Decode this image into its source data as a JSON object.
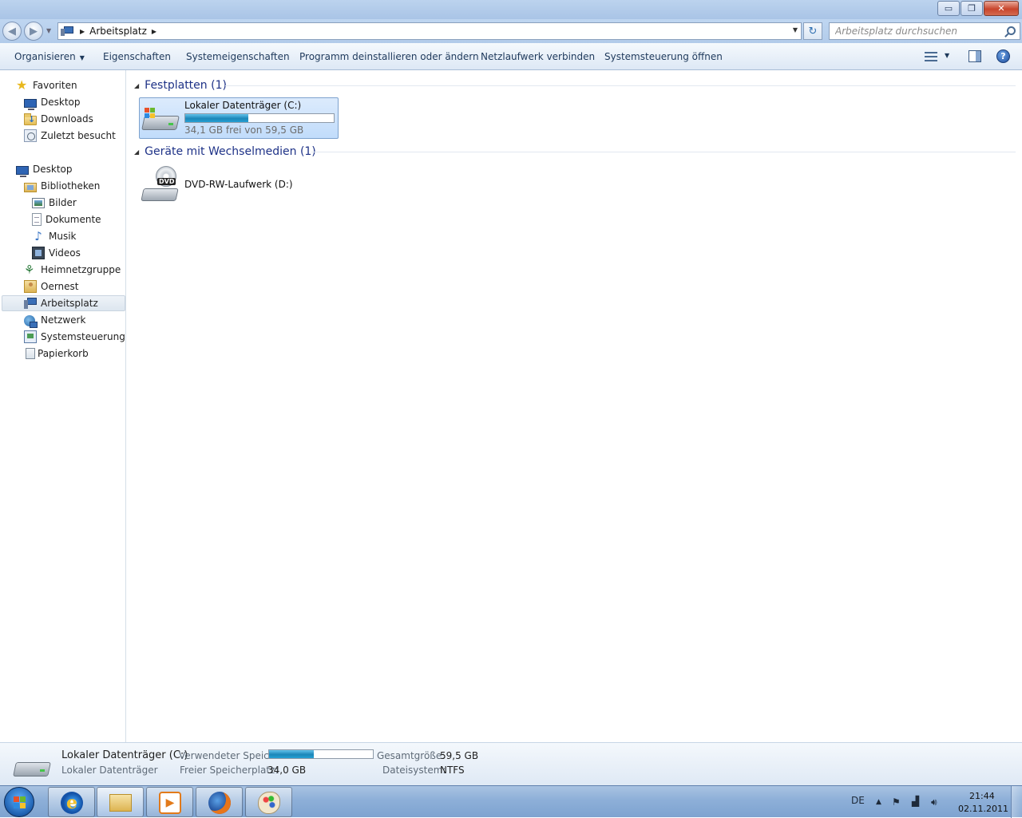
{
  "window": {
    "title": "",
    "minimize": "▭",
    "maximize": "❐",
    "close": "✕"
  },
  "address": {
    "crumbs": [
      "Arbeitsplatz"
    ],
    "search_placeholder": "Arbeitsplatz durchsuchen"
  },
  "toolbar": {
    "items": [
      "Organisieren",
      "Eigenschaften",
      "Systemeigenschaften",
      "Programm deinstallieren oder ändern",
      "Netzlaufwerk verbinden",
      "Systemsteuerung öffnen"
    ],
    "help": "?"
  },
  "nav": {
    "favorites": "Favoriten",
    "fav_items": [
      "Desktop",
      "Downloads",
      "Zuletzt besucht"
    ],
    "desktop": "Desktop",
    "libraries": "Bibliotheken",
    "lib_items": [
      "Bilder",
      "Dokumente",
      "Musik",
      "Videos"
    ],
    "homegroup": "Heimnetzgruppe",
    "user": "Oernest",
    "computer": "Arbeitsplatz",
    "network": "Netzwerk",
    "control_panel": "Systemsteuerung",
    "recycle_bin": "Papierkorb"
  },
  "content": {
    "group_hdd": "Festplatten (1)",
    "group_removable": "Geräte mit Wechselmedien (1)",
    "drive_c": {
      "name": "Lokaler Datenträger (C:)",
      "space": "34,1 GB frei von 59,5 GB",
      "used_fraction": 0.427
    },
    "drive_d": {
      "name": "DVD-RW-Laufwerk (D:)",
      "badge": "DVD"
    }
  },
  "details": {
    "name": "Lokaler Datenträger (C:)",
    "type": "Lokaler Datenträger",
    "used_label": "Verwendeter Speic...",
    "used_fraction": 0.427,
    "free_label": "Freier Speicherplatz:",
    "free_value": "34,0 GB",
    "total_label": "Gesamtgröße:",
    "total_value": "59,5 GB",
    "fs_label": "Dateisystem:",
    "fs_value": "NTFS"
  },
  "taskbar": {
    "language": "DE",
    "time": "21:44",
    "date": "02.11.2011"
  },
  "colors": {
    "accent": "#1e3287",
    "selection": "#c1dcfb",
    "progress": "#26a0d4"
  }
}
